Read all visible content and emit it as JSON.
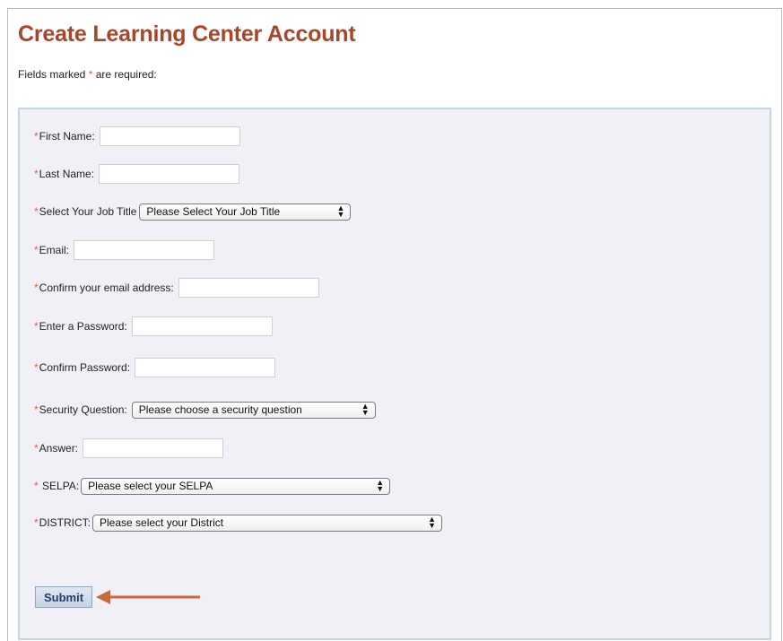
{
  "page": {
    "title": "Create Learning Center Account",
    "required_note_prefix": "Fields marked",
    "required_star": "*",
    "required_note_suffix": "are required:"
  },
  "form": {
    "first_name_label": "First Name:",
    "first_name_value": "",
    "last_name_label": "Last Name:",
    "last_name_value": "",
    "job_title_label": "Select Your Job Title",
    "job_title_selected": "Please Select Your Job Title",
    "email_label": "Email:",
    "email_value": "",
    "confirm_email_label": "Confirm your email address:",
    "confirm_email_value": "",
    "password_label": "Enter a Password:",
    "password_value": "",
    "confirm_password_label": "Confirm Password:",
    "confirm_password_value": "",
    "security_question_label": "Security Question:",
    "security_question_selected": "Please choose a security question",
    "answer_label": "Answer:",
    "answer_value": "",
    "selpa_label": "SELPA:",
    "selpa_selected": "Please select your SELPA",
    "district_label": "DISTRICT:",
    "district_selected": "Please select your District",
    "submit_label": "Submit"
  },
  "colors": {
    "title": "#a8462a",
    "required_star": "#e0623f",
    "panel_bg": "#f1f0f7",
    "panel_border": "#c2d6de",
    "annotation_arrow": "#c8693c"
  },
  "icons": {
    "select_arrows": "updown-chevron-icon",
    "annotation": "left-arrow-icon"
  }
}
